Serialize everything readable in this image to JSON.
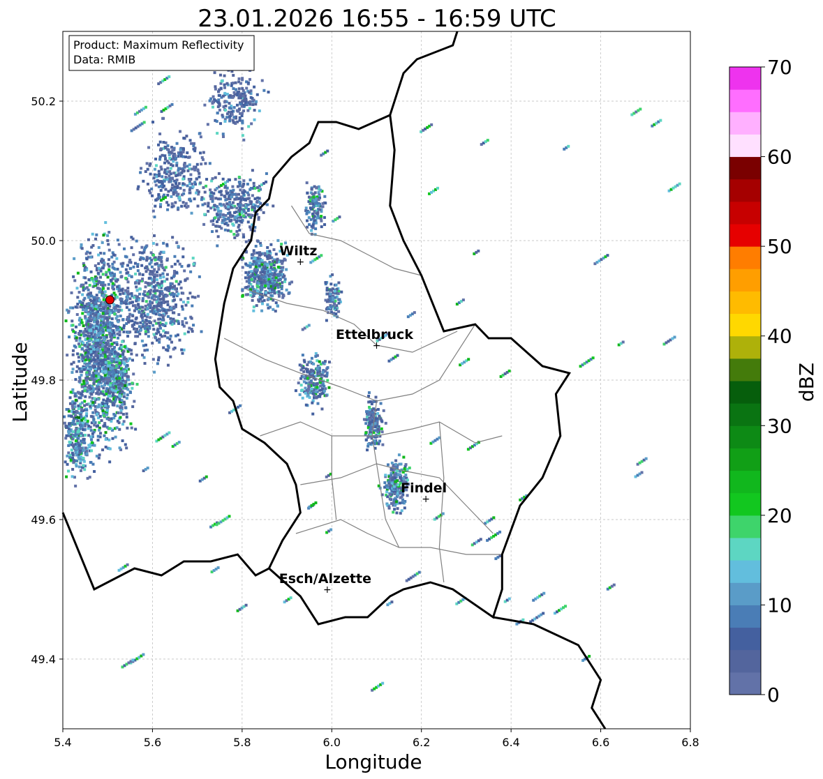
{
  "title": "23.01.2026 16:55 - 16:59 UTC",
  "info_box": {
    "product": "Product: Maximum Reflectivity",
    "data": "Data: RMIB"
  },
  "axes": {
    "xlabel": "Longitude",
    "ylabel": "Latitude",
    "xlim": [
      5.4,
      6.8
    ],
    "ylim": [
      49.3,
      50.3
    ],
    "xticks": [
      "5.4",
      "5.6",
      "5.8",
      "6.0",
      "6.2",
      "6.4",
      "6.6",
      "6.8"
    ],
    "yticks": [
      "49.4",
      "49.6",
      "49.8",
      "50.0",
      "50.2"
    ],
    "grid": true
  },
  "colorbar": {
    "label": "dBZ",
    "range": [
      0,
      70
    ],
    "step": 2.5,
    "ticks": [
      "0",
      "10",
      "20",
      "30",
      "40",
      "50",
      "60",
      "70"
    ],
    "colors": [
      "#6272a8",
      "#53659d",
      "#44609f",
      "#4a7db6",
      "#5a9cc8",
      "#62bedd",
      "#5dd6c2",
      "#3ed46b",
      "#12c71f",
      "#11b71d",
      "#119f16",
      "#0d8a15",
      "#0a7412",
      "#065e0c",
      "#447b0b",
      "#aeb10a",
      "#ffd800",
      "#ffbb00",
      "#ff9e00",
      "#ff7d00",
      "#e60000",
      "#c70000",
      "#a50000",
      "#7a0000",
      "#ffe0ff",
      "#ffb0ff",
      "#ff6eff",
      "#ee33ee"
    ]
  },
  "cities": [
    {
      "name": "Wiltz",
      "lon": 5.93,
      "lat": 49.97
    },
    {
      "name": "Ettelbruck",
      "lon": 6.1,
      "lat": 49.85
    },
    {
      "name": "Findel",
      "lon": 6.21,
      "lat": 49.63
    },
    {
      "name": "Esch/Alzette",
      "lon": 5.99,
      "lat": 49.5
    }
  ],
  "radar_site": {
    "lon": 5.505,
    "lat": 49.915,
    "color": "#e60000"
  },
  "border_color": "#000000",
  "district_color": "#808080"
}
